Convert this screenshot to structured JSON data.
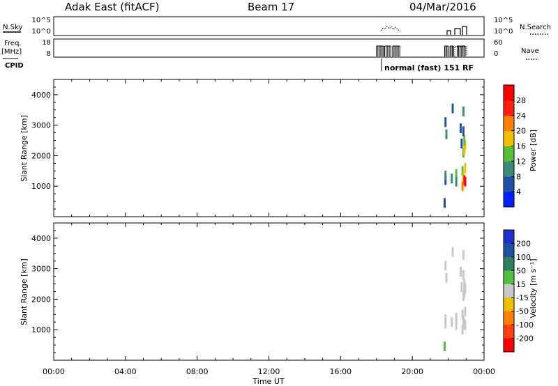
{
  "header": {
    "station": "Adak East (fitACF)",
    "beam": "Beam 17",
    "date": "04/Mar/2016"
  },
  "top_panels": {
    "nsky": {
      "label": "N.Sky",
      "ticks": [
        "10^5",
        "10^0"
      ]
    },
    "nsearch": {
      "label": "N.Search",
      "ticks": [
        "10^5",
        "10^0"
      ]
    },
    "freq": {
      "label_line1": "Freq.",
      "label_line2": "[MHz]",
      "ticks": [
        "18",
        "8"
      ]
    },
    "nave": {
      "label": "Nave",
      "ticks": [
        "60",
        "0"
      ]
    },
    "cpid": {
      "label": "CPID",
      "mode_text": "normal (fast) 151 RF"
    }
  },
  "axes": {
    "xlabel": "Time UT",
    "xticks": [
      "00:00",
      "04:00",
      "08:00",
      "12:00",
      "16:00",
      "20:00",
      "00:00"
    ],
    "ylabel": "Slant Range [km]",
    "yticks": [
      "1000",
      "2000",
      "3000",
      "4000"
    ]
  },
  "power_colorbar": {
    "label": "Power [dB]",
    "ticks": [
      "4",
      "8",
      "12",
      "16",
      "20",
      "24",
      "28"
    ],
    "colors": [
      "#0020ff",
      "#2050a8",
      "#408878",
      "#58c038",
      "#f0c000",
      "#ff8000",
      "#ff2010",
      "#ff0000"
    ]
  },
  "velocity_colorbar": {
    "label": "Velocity [m s⁻¹]",
    "ticks": [
      "200",
      "100",
      "50",
      "15",
      "-15",
      "-50",
      "-100",
      "-200"
    ],
    "colors": [
      "#2030d0",
      "#2050a0",
      "#308060",
      "#50c040",
      "#c8c8c8",
      "#f0c000",
      "#ff8000",
      "#ff4010",
      "#ff0000"
    ]
  },
  "chart_data": [
    {
      "type": "heatmap",
      "panel": "power",
      "xlabel": "Time UT",
      "ylabel": "Slant Range [km]",
      "xlim": [
        0,
        24
      ],
      "ylim": [
        0,
        4500
      ],
      "colorbar": "Power [dB]",
      "clim": [
        0,
        32
      ],
      "cells": [
        {
          "t": 21.85,
          "r": 1200,
          "value": 6
        },
        {
          "t": 21.85,
          "r": 1350,
          "value": 8
        },
        {
          "t": 21.9,
          "r": 2700,
          "value": 8
        },
        {
          "t": 21.85,
          "r": 3100,
          "value": 6
        },
        {
          "t": 21.8,
          "r": 450,
          "value": 4
        },
        {
          "t": 22.2,
          "r": 1250,
          "value": 10
        },
        {
          "t": 22.25,
          "r": 3550,
          "value": 6
        },
        {
          "t": 22.45,
          "r": 1400,
          "value": 12
        },
        {
          "t": 22.45,
          "r": 1150,
          "value": 10
        },
        {
          "t": 22.7,
          "r": 2900,
          "value": 4
        },
        {
          "t": 22.75,
          "r": 2400,
          "value": 6
        },
        {
          "t": 22.8,
          "r": 1500,
          "value": 14
        },
        {
          "t": 22.85,
          "r": 1300,
          "value": 18
        },
        {
          "t": 22.9,
          "r": 1200,
          "value": 26
        },
        {
          "t": 22.95,
          "r": 1150,
          "value": 30
        },
        {
          "t": 22.85,
          "r": 2100,
          "value": 12
        },
        {
          "t": 22.9,
          "r": 2200,
          "value": 16
        },
        {
          "t": 22.95,
          "r": 2350,
          "value": 18
        },
        {
          "t": 22.9,
          "r": 2500,
          "value": 14
        },
        {
          "t": 22.85,
          "r": 2800,
          "value": 6
        },
        {
          "t": 22.85,
          "r": 3450,
          "value": 10
        },
        {
          "t": 22.95,
          "r": 1600,
          "value": 16
        },
        {
          "t": 22.8,
          "r": 1000,
          "value": 20
        }
      ]
    },
    {
      "type": "heatmap",
      "panel": "velocity",
      "xlabel": "Time UT",
      "ylabel": "Slant Range [km]",
      "xlim": [
        0,
        24
      ],
      "ylim": [
        0,
        4500
      ],
      "colorbar": "Velocity [m s⁻¹]",
      "clim": [
        -250,
        250
      ],
      "cells": [
        {
          "t": 21.85,
          "r": 1200,
          "value": 0
        },
        {
          "t": 21.85,
          "r": 1350,
          "value": 5
        },
        {
          "t": 21.9,
          "r": 2700,
          "value": 0
        },
        {
          "t": 21.85,
          "r": 3100,
          "value": 10
        },
        {
          "t": 21.8,
          "r": 450,
          "value": 30
        },
        {
          "t": 22.2,
          "r": 1250,
          "value": 0
        },
        {
          "t": 22.25,
          "r": 3550,
          "value": 0
        },
        {
          "t": 22.45,
          "r": 1400,
          "value": 25
        },
        {
          "t": 22.45,
          "r": 1150,
          "value": 0
        },
        {
          "t": 22.7,
          "r": 2900,
          "value": -5
        },
        {
          "t": 22.75,
          "r": 2400,
          "value": 0
        },
        {
          "t": 22.8,
          "r": 1500,
          "value": 0
        },
        {
          "t": 22.85,
          "r": 1300,
          "value": 5
        },
        {
          "t": 22.9,
          "r": 1200,
          "value": 0
        },
        {
          "t": 22.95,
          "r": 1150,
          "value": -5
        },
        {
          "t": 22.85,
          "r": 2100,
          "value": 0
        },
        {
          "t": 22.9,
          "r": 2200,
          "value": 0
        },
        {
          "t": 22.95,
          "r": 2350,
          "value": 5
        },
        {
          "t": 22.9,
          "r": 2500,
          "value": 0
        },
        {
          "t": 22.85,
          "r": 2800,
          "value": 0
        },
        {
          "t": 22.85,
          "r": 3450,
          "value": 0
        },
        {
          "t": 22.95,
          "r": 1600,
          "value": 20
        },
        {
          "t": 22.8,
          "r": 1000,
          "value": 0
        }
      ]
    },
    {
      "type": "line",
      "panel": "frequency",
      "ylabel": "Freq. [MHz]",
      "ylim": [
        8,
        18
      ],
      "blocks": [
        [
          18.0,
          18.4
        ],
        [
          18.45,
          18.8
        ],
        [
          18.9,
          19.3
        ],
        [
          21.8,
          22.0
        ],
        [
          22.1,
          22.3
        ],
        [
          22.5,
          22.95
        ]
      ]
    }
  ]
}
